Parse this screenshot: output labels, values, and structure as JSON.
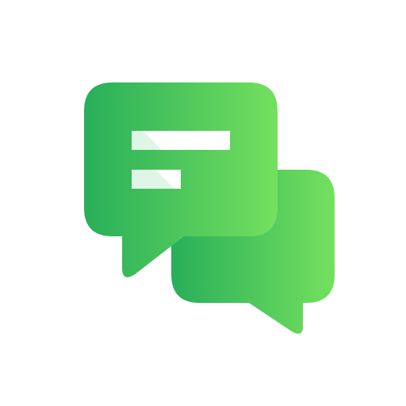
{
  "icon": {
    "name": "chat-bubbles-icon",
    "colors": {
      "gradient_start": "#28AE5A",
      "gradient_end": "#74E05E",
      "text_lines": "#FFFFFF",
      "text_lines_tint": "#DFF6E6",
      "background": "#FFFFFF"
    }
  }
}
